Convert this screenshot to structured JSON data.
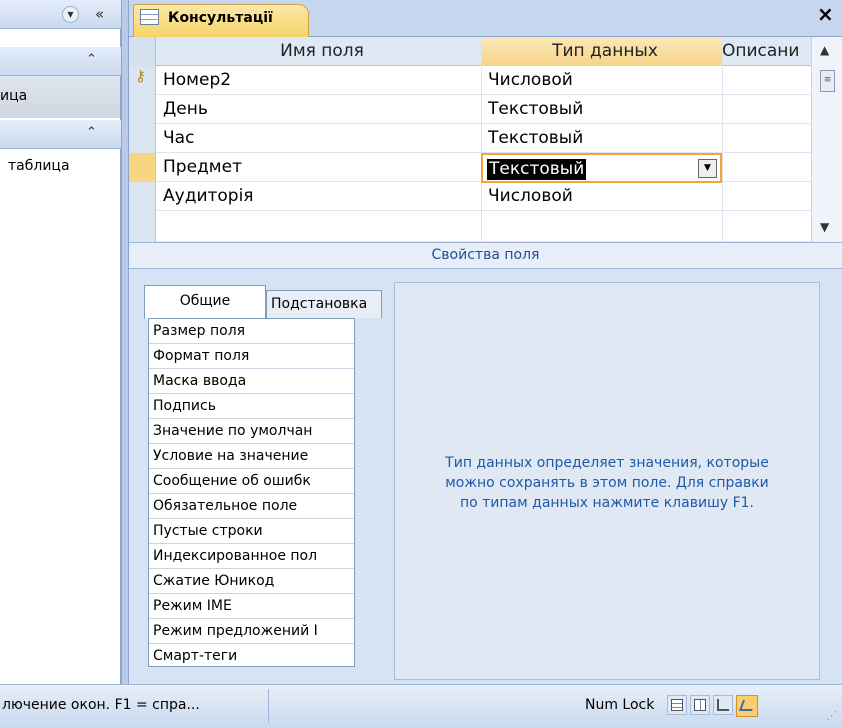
{
  "nav": {
    "section1_label": "ица",
    "section2_label": "таблица"
  },
  "window": {
    "tab_title": "Консультації",
    "close_glyph": "×"
  },
  "design_grid": {
    "columns": [
      "Имя поля",
      "Тип данных",
      "Описани"
    ],
    "rows": [
      {
        "name": "Номер2",
        "type": "Числовой",
        "key": true
      },
      {
        "name": "День",
        "type": "Текстовый",
        "key": false
      },
      {
        "name": "Час",
        "type": "Текстовый",
        "key": false
      },
      {
        "name": "Предмет",
        "type": "Текстовый",
        "key": false,
        "selected": true
      },
      {
        "name": "Аудиторія",
        "type": "Числовой",
        "key": false
      }
    ]
  },
  "properties": {
    "section_title": "Свойства поля",
    "tabs": [
      "Общие",
      "Подстановка"
    ],
    "items": [
      "Размер поля",
      "Формат поля",
      "Маска ввода",
      "Подпись",
      "Значение по умолчан",
      "Условие на значение",
      "Сообщение об ошибк",
      "Обязательное поле",
      "Пустые строки",
      "Индексированное пол",
      "Сжатие Юникод",
      "Режим IME",
      "Режим предложений I",
      "Смарт-теги"
    ],
    "help_text": [
      "Тип данных определяет значения, которые",
      "можно сохранять в этом поле.  Для справки",
      "по типам данных нажмите клавишу F1."
    ]
  },
  "status": {
    "message": "лючение окон.  F1 = спра...",
    "num_lock": "Num Lock"
  },
  "colors": {
    "accent": "#f7d46a",
    "selection_border": "#f5a23a",
    "help_text": "#1e5aa8"
  }
}
